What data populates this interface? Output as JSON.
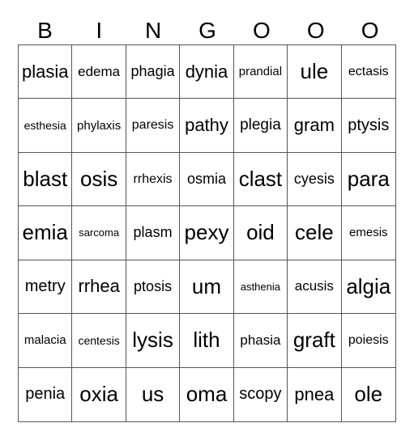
{
  "header": [
    "B",
    "I",
    "N",
    "G",
    "O",
    "O",
    "O"
  ],
  "cells": [
    [
      "plasia",
      "edema",
      "phagia",
      "dynia",
      "prandial",
      "ule",
      "ectasis"
    ],
    [
      "esthesia",
      "phylaxis",
      "paresis",
      "pathy",
      "plegia",
      "gram",
      "ptysis"
    ],
    [
      "blast",
      "osis",
      "rrhexis",
      "osmia",
      "clast",
      "cyesis",
      "para"
    ],
    [
      "emia",
      "sarcoma",
      "plasm",
      "pexy",
      "oid",
      "cele",
      "emesis"
    ],
    [
      "metry",
      "rrhea",
      "ptosis",
      "um",
      "asthenia",
      "acusis",
      "algia"
    ],
    [
      "malacia",
      "centesis",
      "lysis",
      "lith",
      "phasia",
      "graft",
      "poiesis"
    ],
    [
      "penia",
      "oxia",
      "us",
      "oma",
      "scopy",
      "pnea",
      "ole"
    ]
  ]
}
